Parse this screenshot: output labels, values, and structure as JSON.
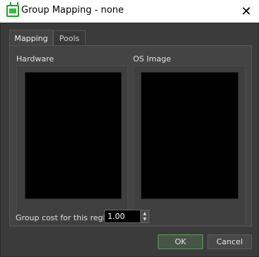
{
  "window": {
    "title": "Group Mapping - none",
    "app_icon": "tv-monitor-icon",
    "close_glyph": "✕"
  },
  "tabs": [
    {
      "label": "Mapping",
      "selected": true
    },
    {
      "label": "Pools",
      "selected": false
    }
  ],
  "mapping": {
    "hardware_label": "Hardware",
    "os_image_label": "OS Image",
    "cost_label": "Group cost for this region:",
    "cost_value": "1.00"
  },
  "buttons": {
    "ok_label": "OK",
    "cancel_label": "Cancel"
  },
  "colors": {
    "background": "#3b3b3b",
    "panel": "#444444",
    "listbox": "#000000",
    "ok_border": "#5e9e5e"
  }
}
